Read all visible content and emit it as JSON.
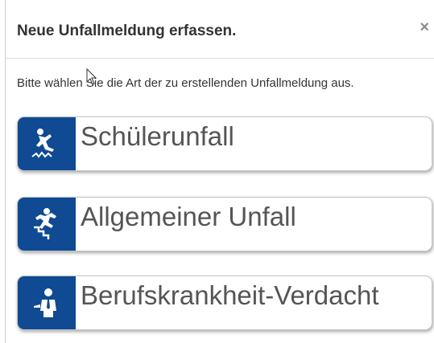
{
  "dialog": {
    "title": "Neue Unfallmeldung erfassen.",
    "close_label": "×",
    "instruction": "Bitte wählen Sie die Art der zu erstellenden Unfallmeldung aus."
  },
  "options": [
    {
      "label": "Schülerunfall",
      "icon": "student-fall-icon"
    },
    {
      "label": "Allgemeiner Unfall",
      "icon": "stairs-fall-icon"
    },
    {
      "label": "Berufskrankheit-Verdacht",
      "icon": "worker-illness-icon"
    }
  ],
  "colors": {
    "icon_tile": "#0f4a92",
    "label_text": "#555555",
    "title_text": "#333333"
  }
}
